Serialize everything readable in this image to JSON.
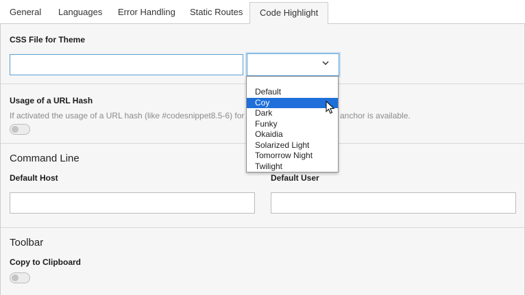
{
  "tabs": [
    {
      "label": "General"
    },
    {
      "label": "Languages"
    },
    {
      "label": "Error Handling"
    },
    {
      "label": "Static Routes"
    },
    {
      "label": "Code Highlight",
      "active": true
    }
  ],
  "css_file": {
    "label": "CSS File for Theme",
    "input_value": "",
    "select_value": "",
    "options": [
      "Default",
      "Coy",
      "Dark",
      "Funky",
      "Okaidia",
      "Solarized Light",
      "Tomorrow Night",
      "Twilight"
    ],
    "highlighted_option": "Coy"
  },
  "url_hash": {
    "label": "Usage of a URL Hash",
    "help_left": "If activated the usage of a URL hash (like #codesnippet8.5-6) for",
    "help_right": "anchor is available.",
    "toggle_on": false
  },
  "command_line": {
    "heading": "Command Line",
    "host_label": "Default Host",
    "host_value": "",
    "user_label": "Default User",
    "user_value": ""
  },
  "toolbar": {
    "heading": "Toolbar",
    "clipboard_label": "Copy to Clipboard",
    "toggle_on": false
  },
  "colors": {
    "accent": "#1e6fd9",
    "focus_border": "#5a9fd4",
    "panel_bg": "#f6f6f6"
  }
}
